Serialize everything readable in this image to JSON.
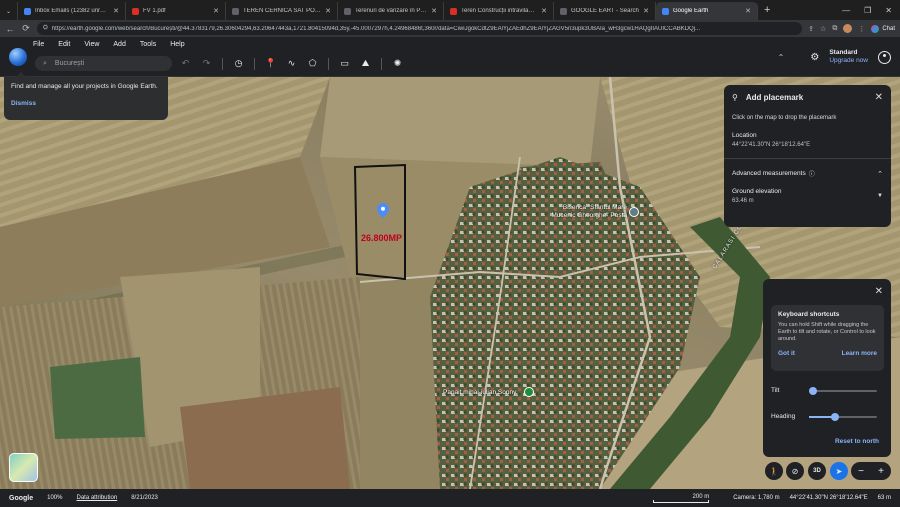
{
  "browser": {
    "tabs": [
      {
        "title": "Inbox Emails (12382 unread) - e...",
        "color": "#4285f4",
        "active": false
      },
      {
        "title": "FV 1.pdf",
        "color": "#d93025",
        "active": false
      },
      {
        "title": "TEREN CERNICA SAT POSTA - Co...",
        "color": "#5f6368",
        "active": false
      },
      {
        "title": "Terenuri de vânzare în Posta, jud...",
        "color": "#5f6368",
        "active": false
      },
      {
        "title": "Teren Construcții intravilan de 12...",
        "color": "#d93025",
        "active": false
      },
      {
        "title": "GOOGLE EART - Search",
        "color": "#5f6368",
        "active": false
      },
      {
        "title": "Google Earth",
        "color": "#4285f4",
        "active": true
      }
    ],
    "newtab_glyph": "+",
    "url": "https://earth.google.com/web/search/București/@44.3783179,26.30604294,63.20647443a,1721.80415094d,35y,-45.0007297h,4.24968486t,360r/data=CiwiJgokCdtZ9EAlYjZAEdhZ9EAlYjZAGV5n3upk3UBAIa_wH3gcw1HAQgIIAUICCABKDQj...",
    "chat_label": "Chat"
  },
  "menu": [
    "File",
    "Edit",
    "View",
    "Add",
    "Tools",
    "Help"
  ],
  "search": {
    "placeholder": "București"
  },
  "account": {
    "plan": "Standard",
    "upgrade": "Upgrade now"
  },
  "tip": {
    "text": "Find and manage all your projects in Google Earth.",
    "dismiss": "Dismiss"
  },
  "placemark": {
    "title": "Add placemark",
    "instruction": "Click on the map to drop the placemark",
    "location_label": "Location",
    "location_value": "44°22'41.30\"N 26°18'12.64\"E",
    "advanced": "Advanced measurements",
    "elevation_label": "Ground elevation",
    "elevation_value": "63.46 m"
  },
  "keyboard": {
    "title": "Keyboard shortcuts",
    "body": "You can hold Shift while dragging the Earth to tilt and rotate, or Control to look around.",
    "got_it": "Got it",
    "learn_more": "Learn more",
    "tilt_label": "Tilt",
    "tilt_level": 0.0,
    "heading_label": "Heading",
    "heading_level": 0.38,
    "reset": "Reset to north"
  },
  "map_labels": {
    "area": "26.800MP",
    "church": "Biserica \"Sfântul Mare Mucenic Gheorghe\" Poșta",
    "pond": "Panait mihai-iulian Sonny",
    "county": "CALARASI COUNTY"
  },
  "status": {
    "google": "Google",
    "zoom": "100%",
    "attribution": "Data attribution",
    "date": "8/21/2023",
    "scale": "200 m",
    "camera": "Camera: 1,780 m",
    "coords": "44°22'41.30\"N 26°18'12.64\"E",
    "elevation": "63 m"
  },
  "colors": {
    "accent": "#8ab4f8",
    "area_text": "#c00020",
    "pin": "#4a8df7"
  }
}
